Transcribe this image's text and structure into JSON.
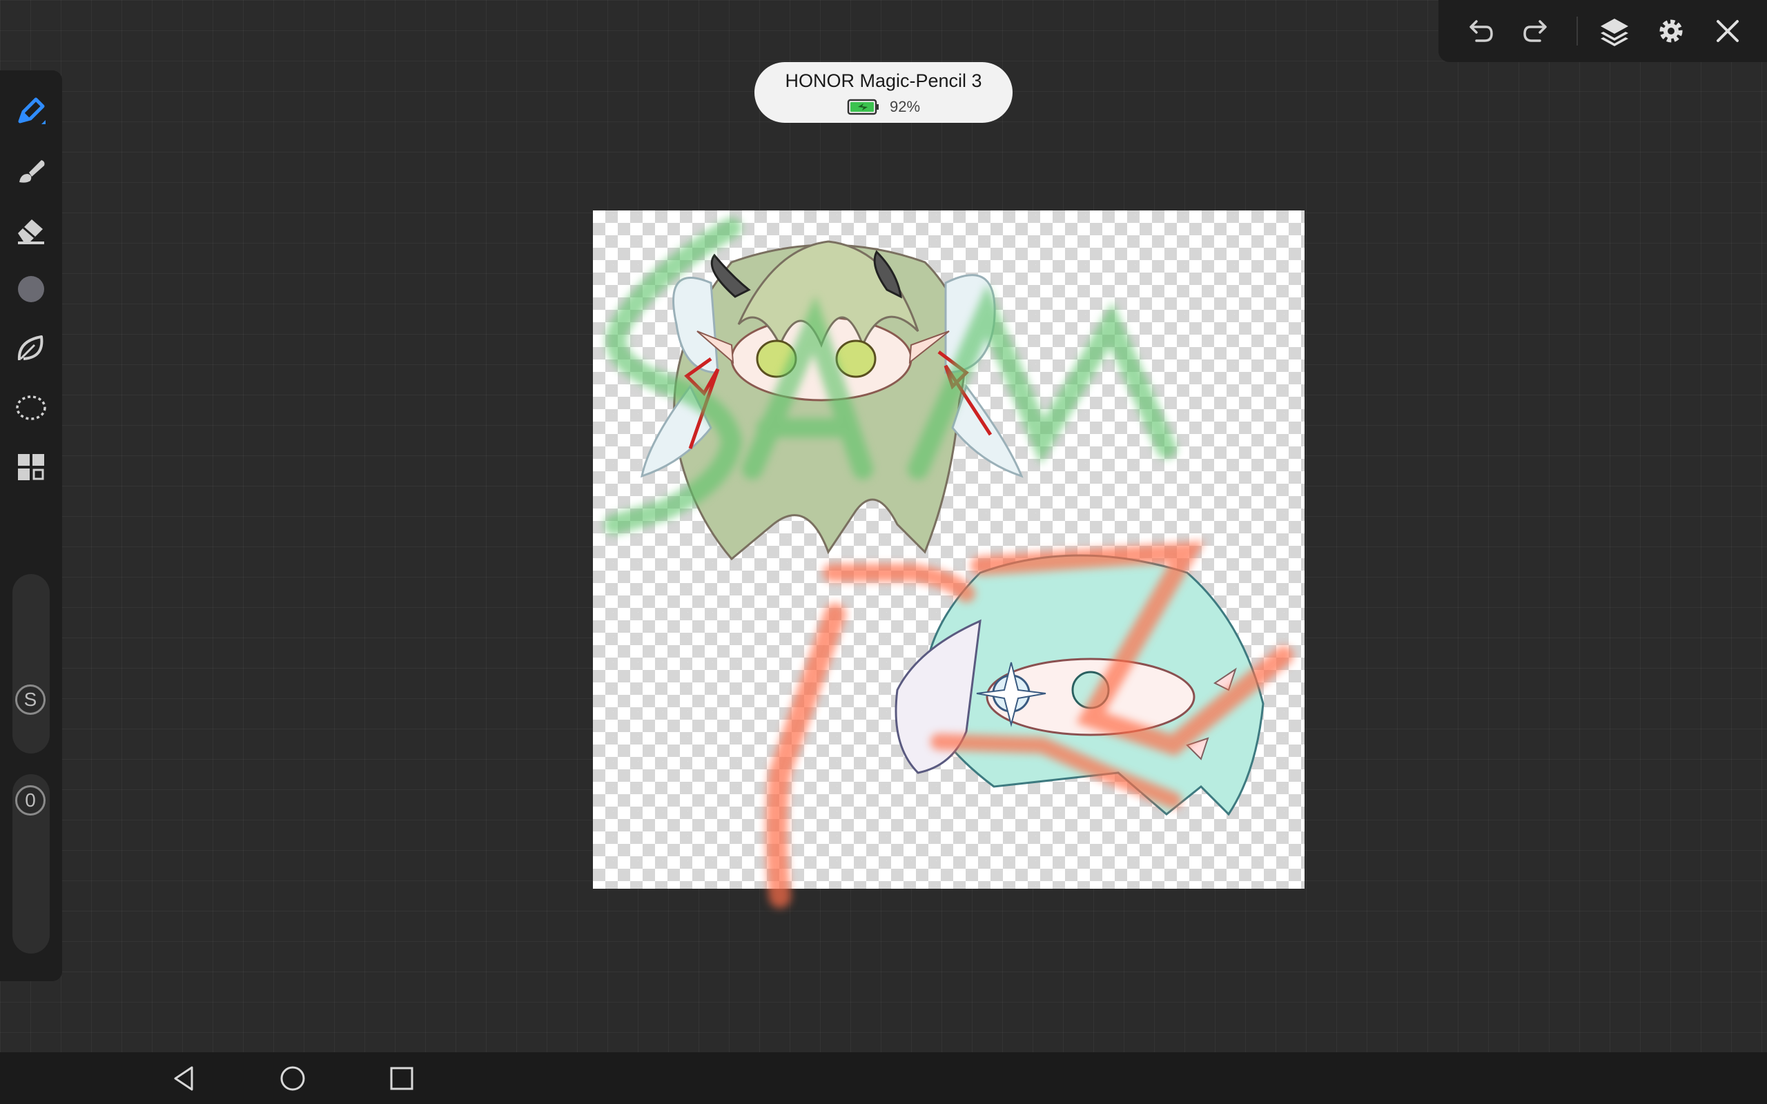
{
  "pencil": {
    "name": "HONOR Magic-Pencil 3",
    "battery_percent": "92%"
  },
  "sliders": {
    "size_label": "S",
    "opacity_value": "0"
  },
  "icons": {
    "left_tools": [
      "pen-icon",
      "brush-icon",
      "eraser-icon",
      "color-swatch-icon",
      "leaf-icon",
      "lasso-icon",
      "grid-icon"
    ],
    "top_tools": [
      "undo-icon",
      "redo-icon",
      "layers-icon",
      "gear-icon",
      "close-icon"
    ],
    "nav": [
      "back-icon",
      "home-icon",
      "recents-icon"
    ]
  },
  "colors": {
    "accent": "#2f8cff",
    "current_color": "#6a6a72",
    "green_stroke": "#5fc46a",
    "orange_stroke": "#ff6e4a",
    "battery": "#3cc24f"
  }
}
